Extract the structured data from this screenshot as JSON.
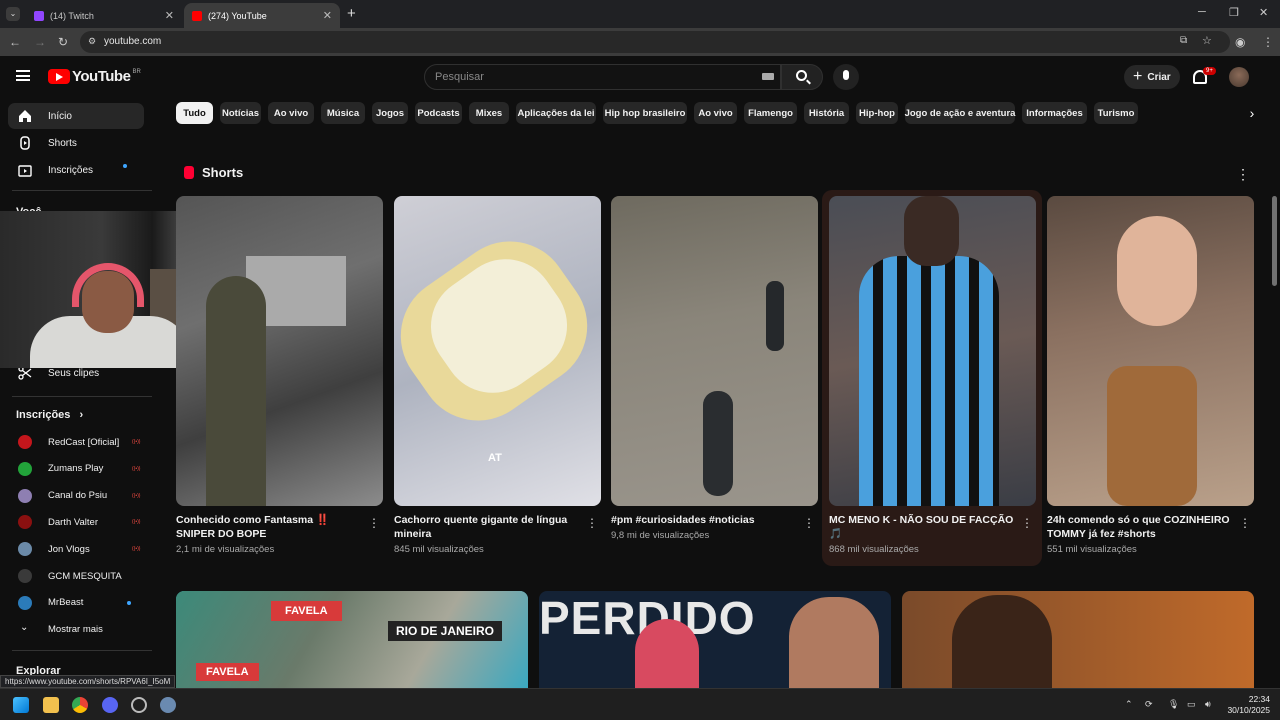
{
  "browser": {
    "tabs": [
      {
        "label": "(14) Twitch",
        "active": false
      },
      {
        "label": "(274) YouTube",
        "active": true
      }
    ],
    "url": "youtube.com",
    "status_url": "https://www.youtube.com/shorts/RPVA6I_I5oM"
  },
  "header": {
    "logo_text": "YouTube",
    "country_code": "BR",
    "search_placeholder": "Pesquisar",
    "create_label": "Criar",
    "notifications_badge": "9+"
  },
  "sidebar": {
    "items": [
      {
        "label": "Início",
        "icon": "home-icon",
        "active": true
      },
      {
        "label": "Shorts",
        "icon": "shorts-icon",
        "active": false
      },
      {
        "label": "Inscrições",
        "icon": "subscriptions-icon",
        "active": false
      }
    ],
    "you_title": "Você",
    "clips_label": "Seus clipes",
    "subscriptions_title": "Inscrições",
    "subscriptions": [
      {
        "name": "RedCast [Oficial]",
        "status": "live",
        "color": "#c4161c"
      },
      {
        "name": "Zumans Play",
        "status": "live",
        "color": "#22a33a"
      },
      {
        "name": "Canal do Psiu",
        "status": "live",
        "color": "#8e7fb2"
      },
      {
        "name": "Darth Valter",
        "status": "live",
        "color": "#8a1010"
      },
      {
        "name": "Jon Vlogs",
        "status": "live",
        "color": "#6b8aa8"
      },
      {
        "name": "GCM MESQUITA",
        "status": "",
        "color": "#3a3a3a"
      },
      {
        "name": "MrBeast",
        "status": "new",
        "color": "#2b7bb9"
      }
    ],
    "show_more": "Mostrar mais",
    "explore_title": "Explorar"
  },
  "chips": [
    "Tudo",
    "Notícias",
    "Ao vivo",
    "Música",
    "Jogos",
    "Podcasts",
    "Mixes",
    "Aplicações da lei",
    "Hip hop brasileiro",
    "Ao vivo",
    "Flamengo",
    "História",
    "Hip-hop",
    "Jogo de ação e aventura",
    "Informações",
    "Turismo"
  ],
  "shorts": {
    "title": "Shorts",
    "cards": [
      {
        "title": "Conhecido como Fantasma ‼️ SNIPER DO BOPE",
        "views": "2,1 mi de visualizações",
        "overlay": ""
      },
      {
        "title": "Cachorro quente gigante de língua mineira",
        "views": "845 mil visualizações",
        "overlay": "AT"
      },
      {
        "title": "#pm #curiosidades #noticias",
        "views": "9,8 mi de visualizações",
        "overlay": ""
      },
      {
        "title": "MC MENO K - NÃO SOU DE FACÇÃO 🎵",
        "views": "868 mil visualizações",
        "overlay": ""
      },
      {
        "title": "24h comendo só o que COZINHEIRO TOMMY já fez #shorts",
        "views": "551 mil visualizações",
        "overlay": ""
      }
    ]
  },
  "bottom_row": {
    "thumb1_labels": [
      "FAVELA",
      "RIO DE JANEIRO",
      "FAVELA"
    ],
    "thumb2_text": "PERDIDO"
  },
  "taskbar": {
    "time": "22:34",
    "date": "30/10/2025"
  },
  "colors": {
    "background": "#0f0f0f",
    "accent_red": "#ff0000",
    "chip_bg": "#272727"
  }
}
